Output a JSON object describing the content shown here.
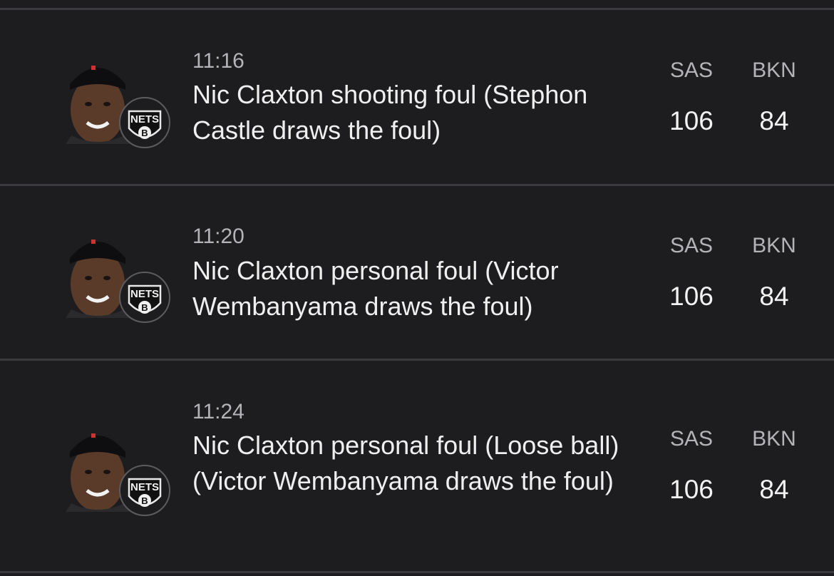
{
  "plays": [
    {
      "time": "11:16",
      "description": "Nic Claxton shooting foul (Stephon Castle draws the foul)",
      "home_abbr": "SAS",
      "away_abbr": "BKN",
      "home_score": "106",
      "away_score": "84",
      "team_logo_text": "NETS",
      "team_logo_letter": "B"
    },
    {
      "time": "11:20",
      "description": "Nic Claxton personal foul (Victor Wembanyama draws the foul)",
      "home_abbr": "SAS",
      "away_abbr": "BKN",
      "home_score": "106",
      "away_score": "84",
      "team_logo_text": "NETS",
      "team_logo_letter": "B"
    },
    {
      "time": "11:24",
      "description": "Nic Claxton personal foul (Loose ball) (Victor Wembanyama draws the foul)",
      "home_abbr": "SAS",
      "away_abbr": "BKN",
      "home_score": "106",
      "away_score": "84",
      "team_logo_text": "NETS",
      "team_logo_letter": "B"
    }
  ],
  "colors": {
    "background": "#1d1d1f",
    "divider": "#3b3b3f",
    "primary_text": "#efefef",
    "secondary_text": "#b4b4b8"
  },
  "icons": {
    "player": "player-headshot",
    "team": "nets-logo-icon"
  }
}
